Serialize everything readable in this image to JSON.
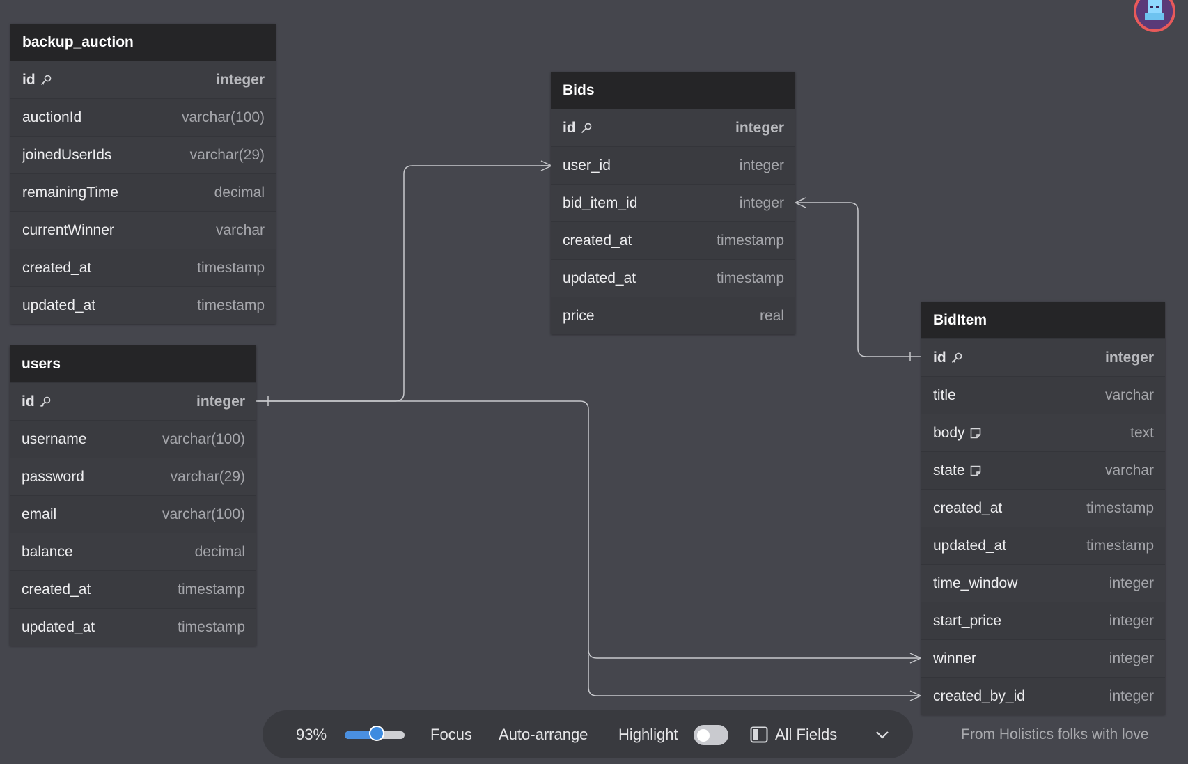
{
  "diagram": {
    "tables": [
      {
        "name": "backup_auction",
        "fields": [
          {
            "name": "id",
            "type": "integer",
            "pk": true
          },
          {
            "name": "auctionId",
            "type": "varchar(100)"
          },
          {
            "name": "joinedUserIds",
            "type": "varchar(29)"
          },
          {
            "name": "remainingTime",
            "type": "decimal"
          },
          {
            "name": "currentWinner",
            "type": "varchar"
          },
          {
            "name": "created_at",
            "type": "timestamp"
          },
          {
            "name": "updated_at",
            "type": "timestamp"
          }
        ]
      },
      {
        "name": "users",
        "fields": [
          {
            "name": "id",
            "type": "integer",
            "pk": true
          },
          {
            "name": "username",
            "type": "varchar(100)"
          },
          {
            "name": "password",
            "type": "varchar(29)"
          },
          {
            "name": "email",
            "type": "varchar(100)"
          },
          {
            "name": "balance",
            "type": "decimal"
          },
          {
            "name": "created_at",
            "type": "timestamp"
          },
          {
            "name": "updated_at",
            "type": "timestamp"
          }
        ]
      },
      {
        "name": "Bids",
        "fields": [
          {
            "name": "id",
            "type": "integer",
            "pk": true
          },
          {
            "name": "user_id",
            "type": "integer"
          },
          {
            "name": "bid_item_id",
            "type": "integer"
          },
          {
            "name": "created_at",
            "type": "timestamp"
          },
          {
            "name": "updated_at",
            "type": "timestamp"
          },
          {
            "name": "price",
            "type": "real"
          }
        ]
      },
      {
        "name": "BidItem",
        "fields": [
          {
            "name": "id",
            "type": "integer",
            "pk": true
          },
          {
            "name": "title",
            "type": "varchar"
          },
          {
            "name": "body",
            "type": "text",
            "note": true
          },
          {
            "name": "state",
            "type": "varchar",
            "note": true
          },
          {
            "name": "created_at",
            "type": "timestamp"
          },
          {
            "name": "updated_at",
            "type": "timestamp"
          },
          {
            "name": "time_window",
            "type": "integer"
          },
          {
            "name": "start_price",
            "type": "integer"
          },
          {
            "name": "winner",
            "type": "integer"
          },
          {
            "name": "created_by_id",
            "type": "integer"
          }
        ]
      }
    ],
    "relations": [
      {
        "from": "users.id",
        "to": "Bids.user_id",
        "cardinality": "one-to-many"
      },
      {
        "from": "BidItem.id",
        "to": "Bids.bid_item_id",
        "cardinality": "one-to-many"
      },
      {
        "from": "users.id",
        "to": "BidItem.winner",
        "cardinality": "one-to-many"
      },
      {
        "from": "users.id",
        "to": "BidItem.created_by_id",
        "cardinality": "one-to-many"
      }
    ]
  },
  "toolbar": {
    "zoom_label": "93%",
    "zoom_level": 0.55,
    "focus_label": "Focus",
    "auto_arrange_label": "Auto-arrange",
    "highlight_label": "Highlight",
    "highlight_on": false,
    "fields_label": "All Fields"
  },
  "footer": {
    "note": "From Holistics folks with love"
  },
  "icons": {
    "pk": "key-icon",
    "note": "note-icon",
    "fields": "panel-icon",
    "dropdown": "chevron-down-icon"
  }
}
